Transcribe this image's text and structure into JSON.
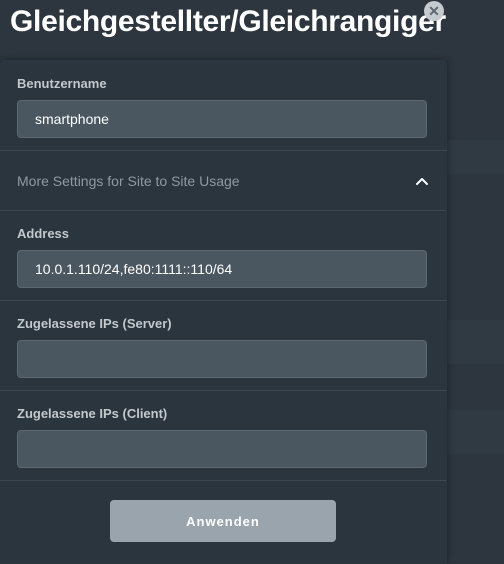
{
  "modal": {
    "title": "Gleichgestellter/Gleichrangiger",
    "close_icon": "close-icon",
    "close_glyph": "✕"
  },
  "fields": {
    "username": {
      "label": "Benutzername",
      "value": "smartphone"
    },
    "more_settings": {
      "label": "More Settings for Site to Site Usage",
      "expanded": true,
      "icon": "chevron-up-icon"
    },
    "address": {
      "label": "Address",
      "value": "10.0.1.110/24,fe80:1111::110/64"
    },
    "allowed_ips_server": {
      "label": "Zugelassene IPs (Server)",
      "value": ""
    },
    "allowed_ips_client": {
      "label": "Zugelassene IPs (Client)",
      "value": ""
    }
  },
  "actions": {
    "apply_label": "Anwenden"
  },
  "colors": {
    "panel_bg": "#2b353d",
    "input_bg": "#4b5760",
    "button_bg": "#9aa4ad",
    "label_text": "#c3c8cd"
  }
}
